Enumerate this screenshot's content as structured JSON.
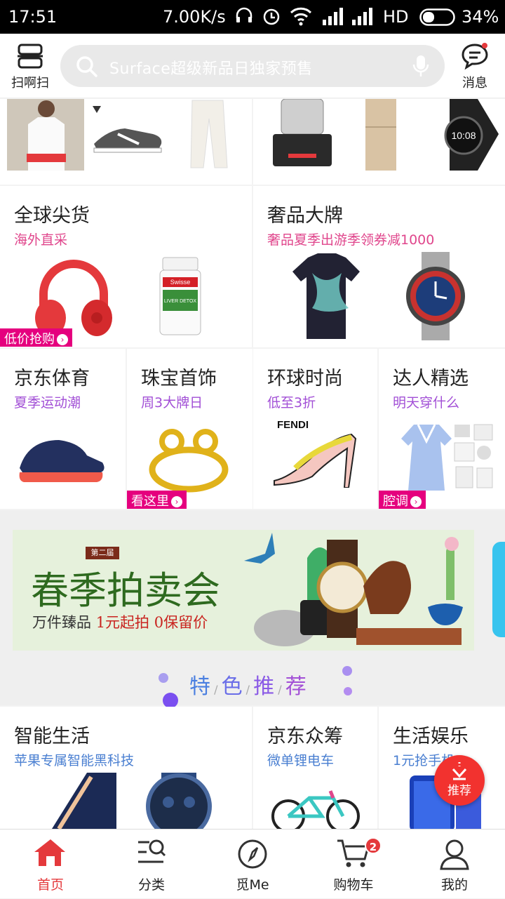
{
  "status_bar": {
    "time": "17:51",
    "speed": "7.00K/s",
    "network": "HD",
    "battery": "34%"
  },
  "header": {
    "scan_label": "扫啊扫",
    "search_placeholder": "Surface超级新品日独家预售",
    "messages_label": "消息"
  },
  "channels_row1": [
    {
      "title": "全球尖货",
      "subtitle": "海外直采",
      "tag": "低价抢购"
    },
    {
      "title": "奢品大牌",
      "subtitle": "奢品夏季出游季领券减1000"
    }
  ],
  "channels_row2": [
    {
      "title": "京东体育",
      "subtitle": "夏季运动潮"
    },
    {
      "title": "珠宝首饰",
      "subtitle": "周3大牌日",
      "tag": "看这里"
    },
    {
      "title": "环球时尚",
      "subtitle": "低至3折",
      "brand": "FENDI"
    },
    {
      "title": "达人精选",
      "subtitle": "明天穿什么",
      "tag": "腔调"
    }
  ],
  "banner": {
    "badge": "第二届",
    "title": "春季拍卖会",
    "subtitle_a": "万件臻品",
    "subtitle_b": "1元起拍",
    "subtitle_c": "0保留价"
  },
  "featured": {
    "chars": [
      "特",
      "色",
      "推",
      "荐"
    ]
  },
  "channels_row3": [
    {
      "title": "智能生活",
      "subtitle": "苹果专属智能黑科技"
    },
    {
      "title": "京东众筹",
      "subtitle": "微单锂电车"
    },
    {
      "title": "生活娱乐",
      "subtitle": "1元抢手机"
    }
  ],
  "float_button": {
    "label": "推荐"
  },
  "bottom_nav": [
    {
      "label": "首页",
      "active": true
    },
    {
      "label": "分类"
    },
    {
      "label": "觅Me"
    },
    {
      "label": "购物车",
      "badge": "2"
    },
    {
      "label": "我的"
    }
  ],
  "colors": {
    "brand_red": "#e4393c",
    "tag_magenta": "#e5007e"
  }
}
